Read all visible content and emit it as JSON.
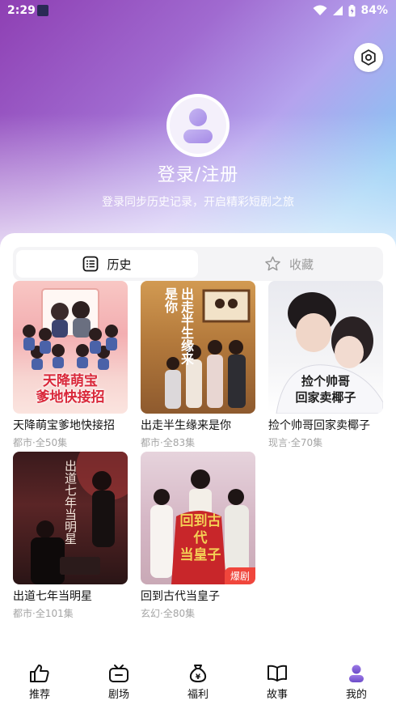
{
  "status_bar": {
    "time": "2:29",
    "battery": "84%"
  },
  "profile": {
    "login_title": "登录/注册",
    "login_subtitle": "登录同步历史记录，开启精彩短剧之旅"
  },
  "tabs": [
    {
      "label": "历史",
      "icon": "list-icon",
      "active": true
    },
    {
      "label": "收藏",
      "icon": "star-icon",
      "active": false
    }
  ],
  "history": [
    {
      "title": "天降萌宝爹地快接招",
      "genre": "都市",
      "episodes": "全50集",
      "meta": "都市·全50集",
      "poster_text": "天降萌宝\n爹地快接招",
      "badge": ""
    },
    {
      "title": "出走半生缘来是你",
      "genre": "都市",
      "episodes": "全83集",
      "meta": "都市·全83集",
      "poster_text": "出走半生\n缘来是你",
      "badge": ""
    },
    {
      "title": "捡个帅哥回家卖椰子",
      "genre": "现言",
      "episodes": "全70集",
      "meta": "现言·全70集",
      "poster_text": "捡个帅哥\n回家卖椰子",
      "badge": ""
    },
    {
      "title": "出道七年当明星",
      "genre": "都市",
      "episodes": "全101集",
      "meta": "都市·全101集",
      "poster_text": "出道七年\n当明星",
      "badge": ""
    },
    {
      "title": "回到古代当皇子",
      "genre": "玄幻",
      "episodes": "全80集",
      "meta": "玄幻·全80集",
      "poster_text": "回到古代\n当皇子",
      "badge": "爆剧"
    }
  ],
  "bottom_nav": [
    {
      "label": "推荐",
      "icon": "thumbs-up-icon"
    },
    {
      "label": "剧场",
      "icon": "tv-icon"
    },
    {
      "label": "福利",
      "icon": "money-bag-icon"
    },
    {
      "label": "故事",
      "icon": "book-icon"
    },
    {
      "label": "我的",
      "icon": "user-icon",
      "active": true
    }
  ],
  "colors": {
    "accent": "#8e6ad8",
    "badge": "#f0463c"
  }
}
